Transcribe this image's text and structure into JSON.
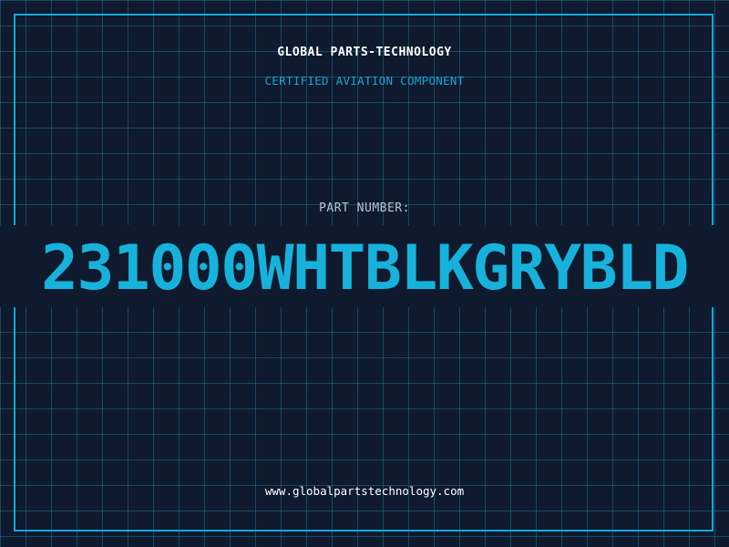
{
  "label": {
    "brand": "GLOBAL PARTS-TECHNOLOGY",
    "subtitle": "CERTIFIED AVIATION COMPONENT",
    "part_number_label": "PART NUMBER:",
    "part_number": "231000WHTBLKGRYBLD",
    "website": "www.globalpartstechnology.com"
  },
  "colors": {
    "background": "#0f1a2e",
    "grid": "#1f6e8c",
    "accent": "#13a9d6",
    "text_light": "#ffffff",
    "text_muted": "#b6c3cf"
  }
}
